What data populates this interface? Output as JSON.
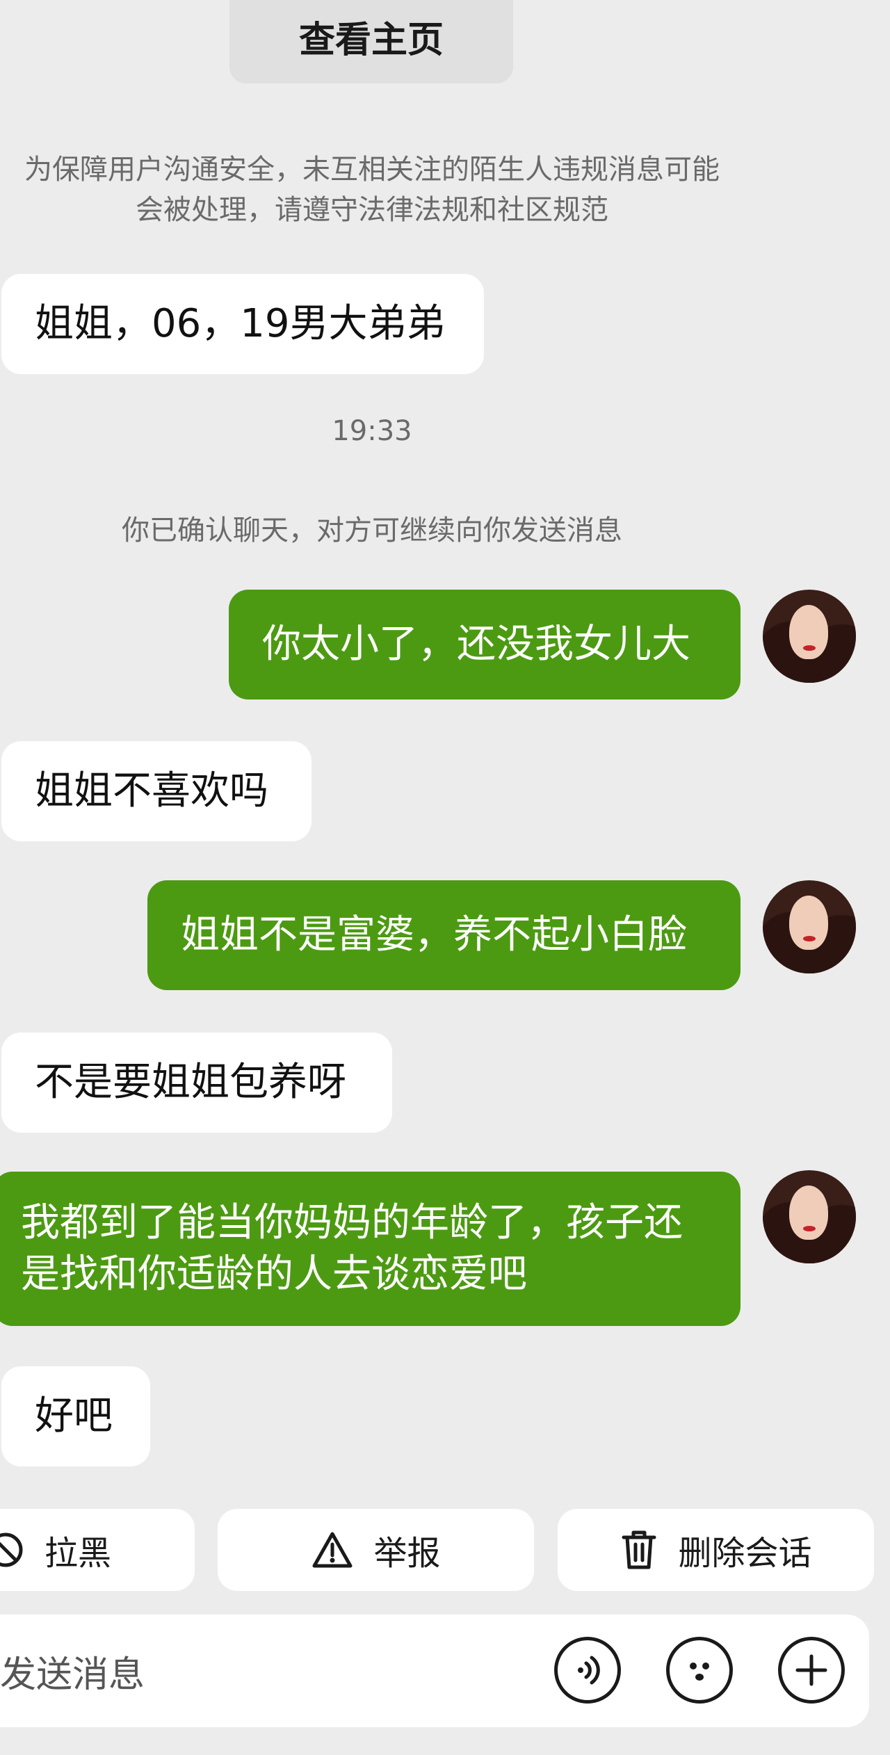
{
  "header": {
    "view_profile_label": "查看主页"
  },
  "notice": {
    "line1": "为保障用户沟通安全，未互相关注的陌生人违规消息可能",
    "line2": "会被处理，请遵守法律法规和社区规范"
  },
  "messages": [
    {
      "side": "in",
      "text": "姐姐，06，19男大弟弟"
    },
    {
      "side": "out",
      "text": "你太小了，还没我女儿大"
    },
    {
      "side": "in",
      "text": "姐姐不喜欢吗"
    },
    {
      "side": "out",
      "text": "姐姐不是富婆，养不起小白脸"
    },
    {
      "side": "in",
      "text": "不是要姐姐包养呀"
    },
    {
      "side": "out",
      "line1": "我都到了能当你妈妈的年龄了，孩子还",
      "line2": "是找和你适龄的人去谈恋爱吧"
    },
    {
      "side": "in",
      "text": "好吧"
    }
  ],
  "timestamp": "19:33",
  "system_message": "你已确认聊天，对方可继续向你发送消息",
  "actions": {
    "block_label": "拉黑",
    "report_label": "举报",
    "delete_label": "删除会话"
  },
  "composer": {
    "placeholder": "发送消息",
    "icons": [
      "voice-icon",
      "emoji-icon",
      "plus-icon"
    ]
  },
  "colors": {
    "background": "#ececec",
    "outgoing_bubble": "#4c9a12",
    "incoming_bubble": "#ffffff",
    "meta_text": "#6a6a6a"
  }
}
